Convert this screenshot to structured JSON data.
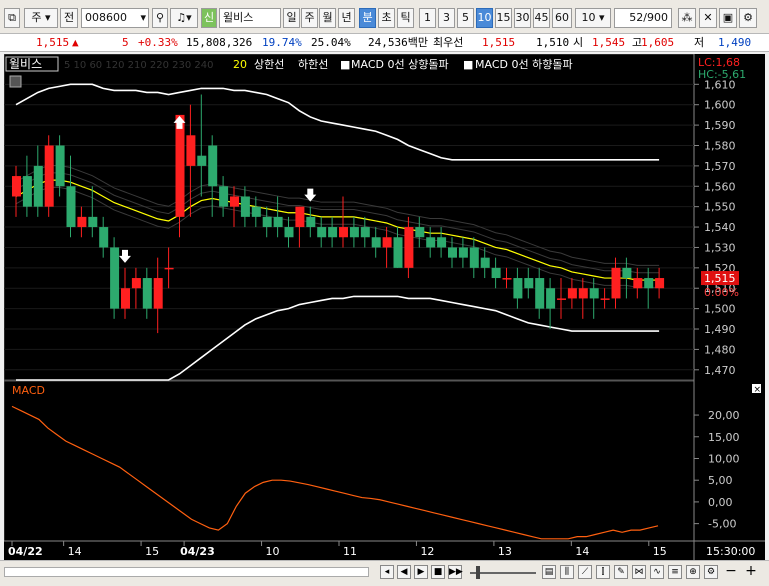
{
  "toolbar": {
    "window_icon": "window-icon",
    "market": "주",
    "prev": "전",
    "code": "008600",
    "search_icon": "search-icon",
    "sound_icon": "speaker-icon",
    "badge": "신",
    "stock_name": "윌비스",
    "periods": [
      "일",
      "주",
      "월",
      "년",
      "분",
      "초",
      "틱"
    ],
    "intervals": [
      "1",
      "3",
      "5",
      "10",
      "15",
      "30",
      "45",
      "60"
    ],
    "selected_interval": "10",
    "interval_select": "10",
    "page": "52",
    "page_total": "/900"
  },
  "info": {
    "price": "1,515",
    "arrow": "▲",
    "change": "5",
    "change_pct": "+0.33%",
    "volume": "15,808,326",
    "vol_ratio": "19.74%",
    "turnover": "25.04%",
    "amount": "24,536백만",
    "best_ask_label": "최우선",
    "best_ask": "1,515",
    "best_bid": "1,510",
    "open_label": "시",
    "open": "1,545",
    "high_label": "고",
    "high": "1,605",
    "low_label": "저",
    "low": "1,490"
  },
  "chart_data": [
    {
      "type": "candlestick",
      "title": "윌비스",
      "legend": [
        "20",
        "상한선",
        "하한선",
        "MACD 0선 상향돌파",
        "MACD 0선 하향돌파"
      ],
      "ma_legend_faint": "5 10 60 120 210 220 230 240",
      "y_ticks": [
        1610,
        1600,
        1590,
        1580,
        1570,
        1560,
        1550,
        1540,
        1530,
        1520,
        1510,
        1500,
        1490,
        1480,
        1470
      ],
      "ylim": [
        1465,
        1618
      ],
      "current_price": "1,515",
      "change_pct_label": "0.00%",
      "lc": "LC:1,68",
      "hc": "HC:-5,61",
      "candles": [
        {
          "o": 1555,
          "h": 1570,
          "l": 1545,
          "c": 1565
        },
        {
          "o": 1565,
          "h": 1575,
          "l": 1545,
          "c": 1550
        },
        {
          "o": 1570,
          "h": 1580,
          "l": 1545,
          "c": 1550
        },
        {
          "o": 1550,
          "h": 1585,
          "l": 1545,
          "c": 1580
        },
        {
          "o": 1580,
          "h": 1585,
          "l": 1555,
          "c": 1560
        },
        {
          "o": 1560,
          "h": 1575,
          "l": 1535,
          "c": 1540
        },
        {
          "o": 1540,
          "h": 1550,
          "l": 1535,
          "c": 1545
        },
        {
          "o": 1545,
          "h": 1560,
          "l": 1535,
          "c": 1540
        },
        {
          "o": 1540,
          "h": 1545,
          "l": 1525,
          "c": 1530
        },
        {
          "o": 1530,
          "h": 1535,
          "l": 1495,
          "c": 1500
        },
        {
          "o": 1500,
          "h": 1520,
          "l": 1495,
          "c": 1510
        },
        {
          "o": 1510,
          "h": 1520,
          "l": 1500,
          "c": 1515
        },
        {
          "o": 1515,
          "h": 1520,
          "l": 1495,
          "c": 1500
        },
        {
          "o": 1500,
          "h": 1525,
          "l": 1488,
          "c": 1515
        },
        {
          "o": 1520,
          "h": 1530,
          "l": 1510,
          "c": 1520
        },
        {
          "o": 1545,
          "h": 1565,
          "l": 1535,
          "c": 1595
        },
        {
          "o": 1570,
          "h": 1600,
          "l": 1545,
          "c": 1585
        },
        {
          "o": 1575,
          "h": 1605,
          "l": 1555,
          "c": 1570
        },
        {
          "o": 1580,
          "h": 1585,
          "l": 1545,
          "c": 1560
        },
        {
          "o": 1560,
          "h": 1565,
          "l": 1545,
          "c": 1550
        },
        {
          "o": 1550,
          "h": 1560,
          "l": 1540,
          "c": 1555
        },
        {
          "o": 1555,
          "h": 1560,
          "l": 1540,
          "c": 1545
        },
        {
          "o": 1550,
          "h": 1555,
          "l": 1540,
          "c": 1545
        },
        {
          "o": 1545,
          "h": 1550,
          "l": 1535,
          "c": 1540
        },
        {
          "o": 1545,
          "h": 1555,
          "l": 1535,
          "c": 1540
        },
        {
          "o": 1540,
          "h": 1545,
          "l": 1530,
          "c": 1535
        },
        {
          "o": 1540,
          "h": 1550,
          "l": 1530,
          "c": 1550
        },
        {
          "o": 1545,
          "h": 1550,
          "l": 1535,
          "c": 1540
        },
        {
          "o": 1540,
          "h": 1545,
          "l": 1530,
          "c": 1535
        },
        {
          "o": 1540,
          "h": 1545,
          "l": 1530,
          "c": 1535
        },
        {
          "o": 1535,
          "h": 1555,
          "l": 1530,
          "c": 1540
        },
        {
          "o": 1540,
          "h": 1545,
          "l": 1530,
          "c": 1535
        },
        {
          "o": 1540,
          "h": 1545,
          "l": 1530,
          "c": 1535
        },
        {
          "o": 1535,
          "h": 1540,
          "l": 1525,
          "c": 1530
        },
        {
          "o": 1530,
          "h": 1540,
          "l": 1520,
          "c": 1535
        },
        {
          "o": 1535,
          "h": 1540,
          "l": 1520,
          "c": 1520
        },
        {
          "o": 1520,
          "h": 1545,
          "l": 1515,
          "c": 1540
        },
        {
          "o": 1540,
          "h": 1545,
          "l": 1530,
          "c": 1535
        },
        {
          "o": 1535,
          "h": 1540,
          "l": 1525,
          "c": 1530
        },
        {
          "o": 1535,
          "h": 1540,
          "l": 1525,
          "c": 1530
        },
        {
          "o": 1530,
          "h": 1535,
          "l": 1520,
          "c": 1525
        },
        {
          "o": 1530,
          "h": 1535,
          "l": 1520,
          "c": 1525
        },
        {
          "o": 1530,
          "h": 1535,
          "l": 1515,
          "c": 1520
        },
        {
          "o": 1525,
          "h": 1530,
          "l": 1515,
          "c": 1520
        },
        {
          "o": 1520,
          "h": 1525,
          "l": 1510,
          "c": 1515
        },
        {
          "o": 1515,
          "h": 1520,
          "l": 1510,
          "c": 1515
        },
        {
          "o": 1515,
          "h": 1520,
          "l": 1500,
          "c": 1505
        },
        {
          "o": 1515,
          "h": 1520,
          "l": 1505,
          "c": 1510
        },
        {
          "o": 1515,
          "h": 1520,
          "l": 1495,
          "c": 1500
        },
        {
          "o": 1510,
          "h": 1515,
          "l": 1490,
          "c": 1500
        },
        {
          "o": 1505,
          "h": 1515,
          "l": 1495,
          "c": 1505
        },
        {
          "o": 1505,
          "h": 1515,
          "l": 1500,
          "c": 1510
        },
        {
          "o": 1505,
          "h": 1515,
          "l": 1495,
          "c": 1510
        },
        {
          "o": 1510,
          "h": 1515,
          "l": 1495,
          "c": 1505
        },
        {
          "o": 1505,
          "h": 1510,
          "l": 1500,
          "c": 1505
        },
        {
          "o": 1505,
          "h": 1525,
          "l": 1500,
          "c": 1520
        },
        {
          "o": 1520,
          "h": 1525,
          "l": 1505,
          "c": 1515
        },
        {
          "o": 1510,
          "h": 1520,
          "l": 1505,
          "c": 1515
        },
        {
          "o": 1515,
          "h": 1520,
          "l": 1500,
          "c": 1510
        },
        {
          "o": 1510,
          "h": 1520,
          "l": 1505,
          "c": 1515
        }
      ],
      "ma20": [
        1555,
        1558,
        1561,
        1563,
        1563,
        1562,
        1560,
        1558,
        1555,
        1552,
        1550,
        1548,
        1546,
        1544,
        1543,
        1546,
        1550,
        1553,
        1554,
        1553,
        1552,
        1551,
        1550,
        1549,
        1548,
        1547,
        1547,
        1546,
        1545,
        1545,
        1545,
        1545,
        1544,
        1543,
        1542,
        1540,
        1539,
        1538,
        1537,
        1537,
        1536,
        1535,
        1534,
        1532,
        1530,
        1529,
        1527,
        1525,
        1523,
        1521,
        1520,
        1518,
        1517,
        1516,
        1515,
        1515,
        1515,
        1514,
        1514,
        1514
      ],
      "upper": [
        1600,
        1603,
        1606,
        1608,
        1609,
        1610,
        1610,
        1610,
        1608,
        1607,
        1607,
        1607,
        1606,
        1606,
        1605,
        1606,
        1607,
        1608,
        1608,
        1608,
        1607,
        1607,
        1606,
        1605,
        1603,
        1601,
        1597,
        1594,
        1592,
        1591,
        1590,
        1589,
        1588,
        1587,
        1585,
        1583,
        1580,
        1578,
        1576,
        1574,
        1573,
        1573,
        1573,
        1573,
        1573,
        1573,
        1573,
        1573,
        1573,
        1573,
        1573,
        1573,
        1573,
        1573,
        1573,
        1573,
        1573,
        1573,
        1573,
        1573
      ],
      "lower": [
        1465,
        1465,
        1465,
        1465,
        1465,
        1465,
        1465,
        1465,
        1465,
        1465,
        1465,
        1465,
        1465,
        1465,
        1465,
        1468,
        1472,
        1476,
        1480,
        1484,
        1488,
        1492,
        1495,
        1497,
        1499,
        1500,
        1502,
        1503,
        1504,
        1505,
        1505,
        1506,
        1506,
        1506,
        1506,
        1506,
        1505,
        1505,
        1505,
        1504,
        1503,
        1502,
        1501,
        1500,
        1499,
        1497,
        1495,
        1493,
        1492,
        1491,
        1490,
        1489,
        1489,
        1489,
        1489,
        1489,
        1489,
        1489,
        1489,
        1489
      ],
      "signals": [
        {
          "index": 10,
          "direction": "down"
        },
        {
          "index": 15,
          "direction": "up"
        },
        {
          "index": 27,
          "direction": "down"
        }
      ]
    },
    {
      "type": "line",
      "title": "MACD",
      "y_ticks": [
        20,
        15,
        10,
        5,
        0,
        -5
      ],
      "y_tick_labels": [
        "20,00",
        "15,00",
        "10,00",
        "5,00",
        "0,00",
        "-5,00"
      ],
      "ylim": [
        -9,
        26
      ],
      "values": [
        22,
        21,
        20,
        19,
        17,
        15.5,
        14,
        13,
        12,
        11,
        10,
        9,
        8,
        6.5,
        5,
        3.5,
        2,
        0.5,
        -1,
        -2.5,
        -4,
        -5,
        -6,
        -6.5,
        -5,
        -1,
        2,
        3.5,
        4.5,
        5,
        5,
        4.8,
        4.4,
        4,
        3.5,
        3,
        2.5,
        2,
        1.5,
        1,
        0.8,
        0.5,
        0,
        -0.5,
        -1,
        -1.5,
        -2,
        -2.5,
        -3,
        -3.5,
        -4,
        -4.5,
        -5,
        -5.5,
        -6,
        -6.5,
        -7,
        -7.5,
        -8,
        -8.5,
        -8.5,
        -8.5,
        -8.5,
        -8,
        -8,
        -7.5,
        -7,
        -6.5,
        -7,
        -6.5,
        -6.5,
        -6,
        -5.5
      ]
    }
  ],
  "x_labels": [
    {
      "label": "04/22",
      "index": 0,
      "bold": true
    },
    {
      "label": "14",
      "index": 6
    },
    {
      "label": "15",
      "index": 15
    },
    {
      "label": "04/23",
      "index": 20,
      "bold": true
    },
    {
      "label": "10",
      "index": 29
    },
    {
      "label": "11",
      "index": 38
    },
    {
      "label": "12",
      "index": 47
    },
    {
      "label": "13",
      "index": 56
    },
    {
      "label": "14",
      "index": 65
    },
    {
      "label": "15",
      "index": 74
    }
  ],
  "time_label": "15:30:00",
  "colors": {
    "up": "#ff2020",
    "down": "#2daa6e",
    "ma20": "#ffff00",
    "band": "#ffffff",
    "macd": "#ff6010",
    "price_tag": "#e01010"
  },
  "statusbar": {
    "buttons": [
      "◀",
      "▶",
      "■",
      "▶▶"
    ],
    "zoom_icons": [
      "−",
      "+"
    ]
  }
}
